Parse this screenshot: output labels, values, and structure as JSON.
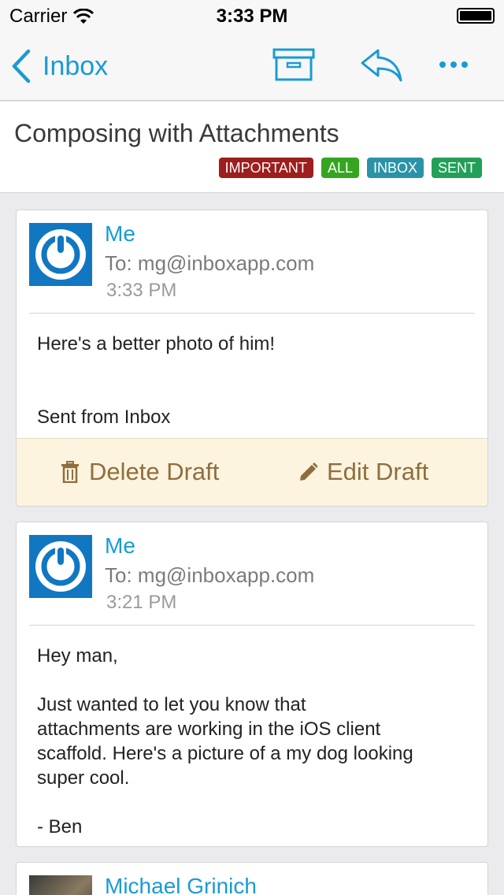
{
  "status_bar": {
    "carrier": "Carrier",
    "time": "3:33 PM"
  },
  "nav": {
    "back_label": "Inbox",
    "icons": [
      "chevron-left-icon",
      "archive-icon",
      "reply-icon",
      "more-icon"
    ]
  },
  "thread": {
    "subject": "Composing with Attachments",
    "labels": [
      {
        "text": "IMPORTANT",
        "color": "#9e1d1d"
      },
      {
        "text": "ALL",
        "color": "#35a51f"
      },
      {
        "text": "INBOX",
        "color": "#2a93a8"
      },
      {
        "text": "SENT",
        "color": "#22a05a"
      }
    ]
  },
  "messages": [
    {
      "sender": "Me",
      "to": "To: mg@inboxapp.com",
      "time": "3:33 PM",
      "body": "Here's a better photo of him!\n\n\nSent from Inbox",
      "draft_actions": {
        "delete_label": "Delete Draft",
        "edit_label": "Edit Draft"
      }
    },
    {
      "sender": "Me",
      "to": "To: mg@inboxapp.com",
      "time": "3:21 PM",
      "body": "Hey man,\n\nJust wanted to let you know that\nattachments are working in the iOS client\nscaffold. Here's a picture of a my dog looking\nsuper cool.\n\n- Ben"
    },
    {
      "sender": "Michael Grinich"
    }
  ],
  "colors": {
    "accent": "#1a9bd3",
    "draft_bg": "#fdf4df",
    "draft_text": "#8f6e3e",
    "avatar_bg": "#1177c1"
  }
}
